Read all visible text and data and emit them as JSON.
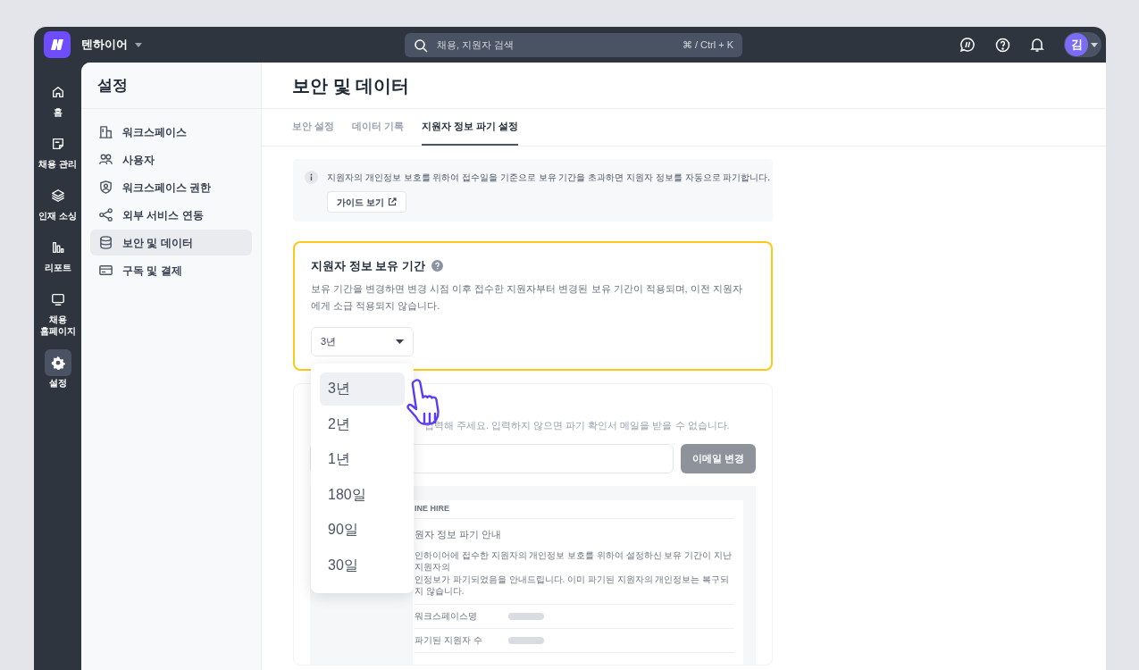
{
  "workspace": {
    "name": "텐하이어"
  },
  "search": {
    "placeholder": "채용, 지원자 검색",
    "shortcut": "⌘ / Ctrl + K"
  },
  "user": {
    "avatar": "김"
  },
  "nav_rail": [
    {
      "kind": "home",
      "label": "홈",
      "selected": false
    },
    {
      "kind": "note",
      "label": "채용 관리",
      "selected": false
    },
    {
      "kind": "layers",
      "label": "인재 소싱",
      "selected": false
    },
    {
      "kind": "bars",
      "label": "리포트",
      "selected": false
    },
    {
      "kind": "monitor",
      "label": "채용 홈페이지",
      "selected": false
    },
    {
      "kind": "gear",
      "label": "설정",
      "selected": true
    }
  ],
  "settings_sidebar": {
    "title": "설정",
    "items": [
      {
        "kind": "building",
        "label": "워크스페이스",
        "selected": false
      },
      {
        "kind": "users",
        "label": "사용자",
        "selected": false
      },
      {
        "kind": "shield",
        "label": "워크스페이스 권한",
        "selected": false
      },
      {
        "kind": "share",
        "label": "외부 서비스 연동",
        "selected": false
      },
      {
        "kind": "database",
        "label": "보안 및 데이터",
        "selected": true
      },
      {
        "kind": "card",
        "label": "구독 및 결제",
        "selected": false
      }
    ]
  },
  "page": {
    "title": "보안 및 데이터",
    "tabs": [
      {
        "label": "보안 설정",
        "selected": false
      },
      {
        "label": "데이터 기록",
        "selected": false
      },
      {
        "label": "지원자 정보 파기 설정",
        "selected": true
      }
    ]
  },
  "notice": {
    "text": "지원자의 개인정보 보호를 위하여 접수일을 기준으로 보유 기간을 초과하면 지원자 정보를 자동으로 파기합니다.",
    "button": "가이드 보기"
  },
  "retention": {
    "title": "지원자 정보 보유 기간",
    "description": "보유 기간을 변경하면 변경 시점 이후 접수한 지원자부터 변경된 보유 기간이 적용되며, 이전 지원자에게 소급 적용되지 않습니다.",
    "dropdown": {
      "value": "3년",
      "expanded": true,
      "options": [
        {
          "label": "3년",
          "selected": true
        },
        {
          "label": "2년",
          "selected": false
        },
        {
          "label": "1년",
          "selected": false
        },
        {
          "label": "180일",
          "selected": false
        },
        {
          "label": "90일",
          "selected": false
        },
        {
          "label": "30일",
          "selected": false
        }
      ]
    }
  },
  "email_section": {
    "description": "입력해 주세요. 입력하지 않으면 파기 확인서 메일을 받을 수 없습니다.",
    "button": {
      "label": "이메일 변경",
      "disabled": true
    }
  },
  "email_preview": {
    "brand": "INE HIRE",
    "title": "원자 정보 파기 안내",
    "body": [
      "인하이어에 접수한 지원자의 개인정보 보호를 위하여 설정하신 보유 기간이 지난 지원자의",
      "인정보가 파기되었음을 안내드립니다. 이미 파기된 지원자의 개인정보는 복구되지 않습니다."
    ],
    "fields": [
      "워크스페이스명",
      "파기된 지원자 수"
    ]
  }
}
